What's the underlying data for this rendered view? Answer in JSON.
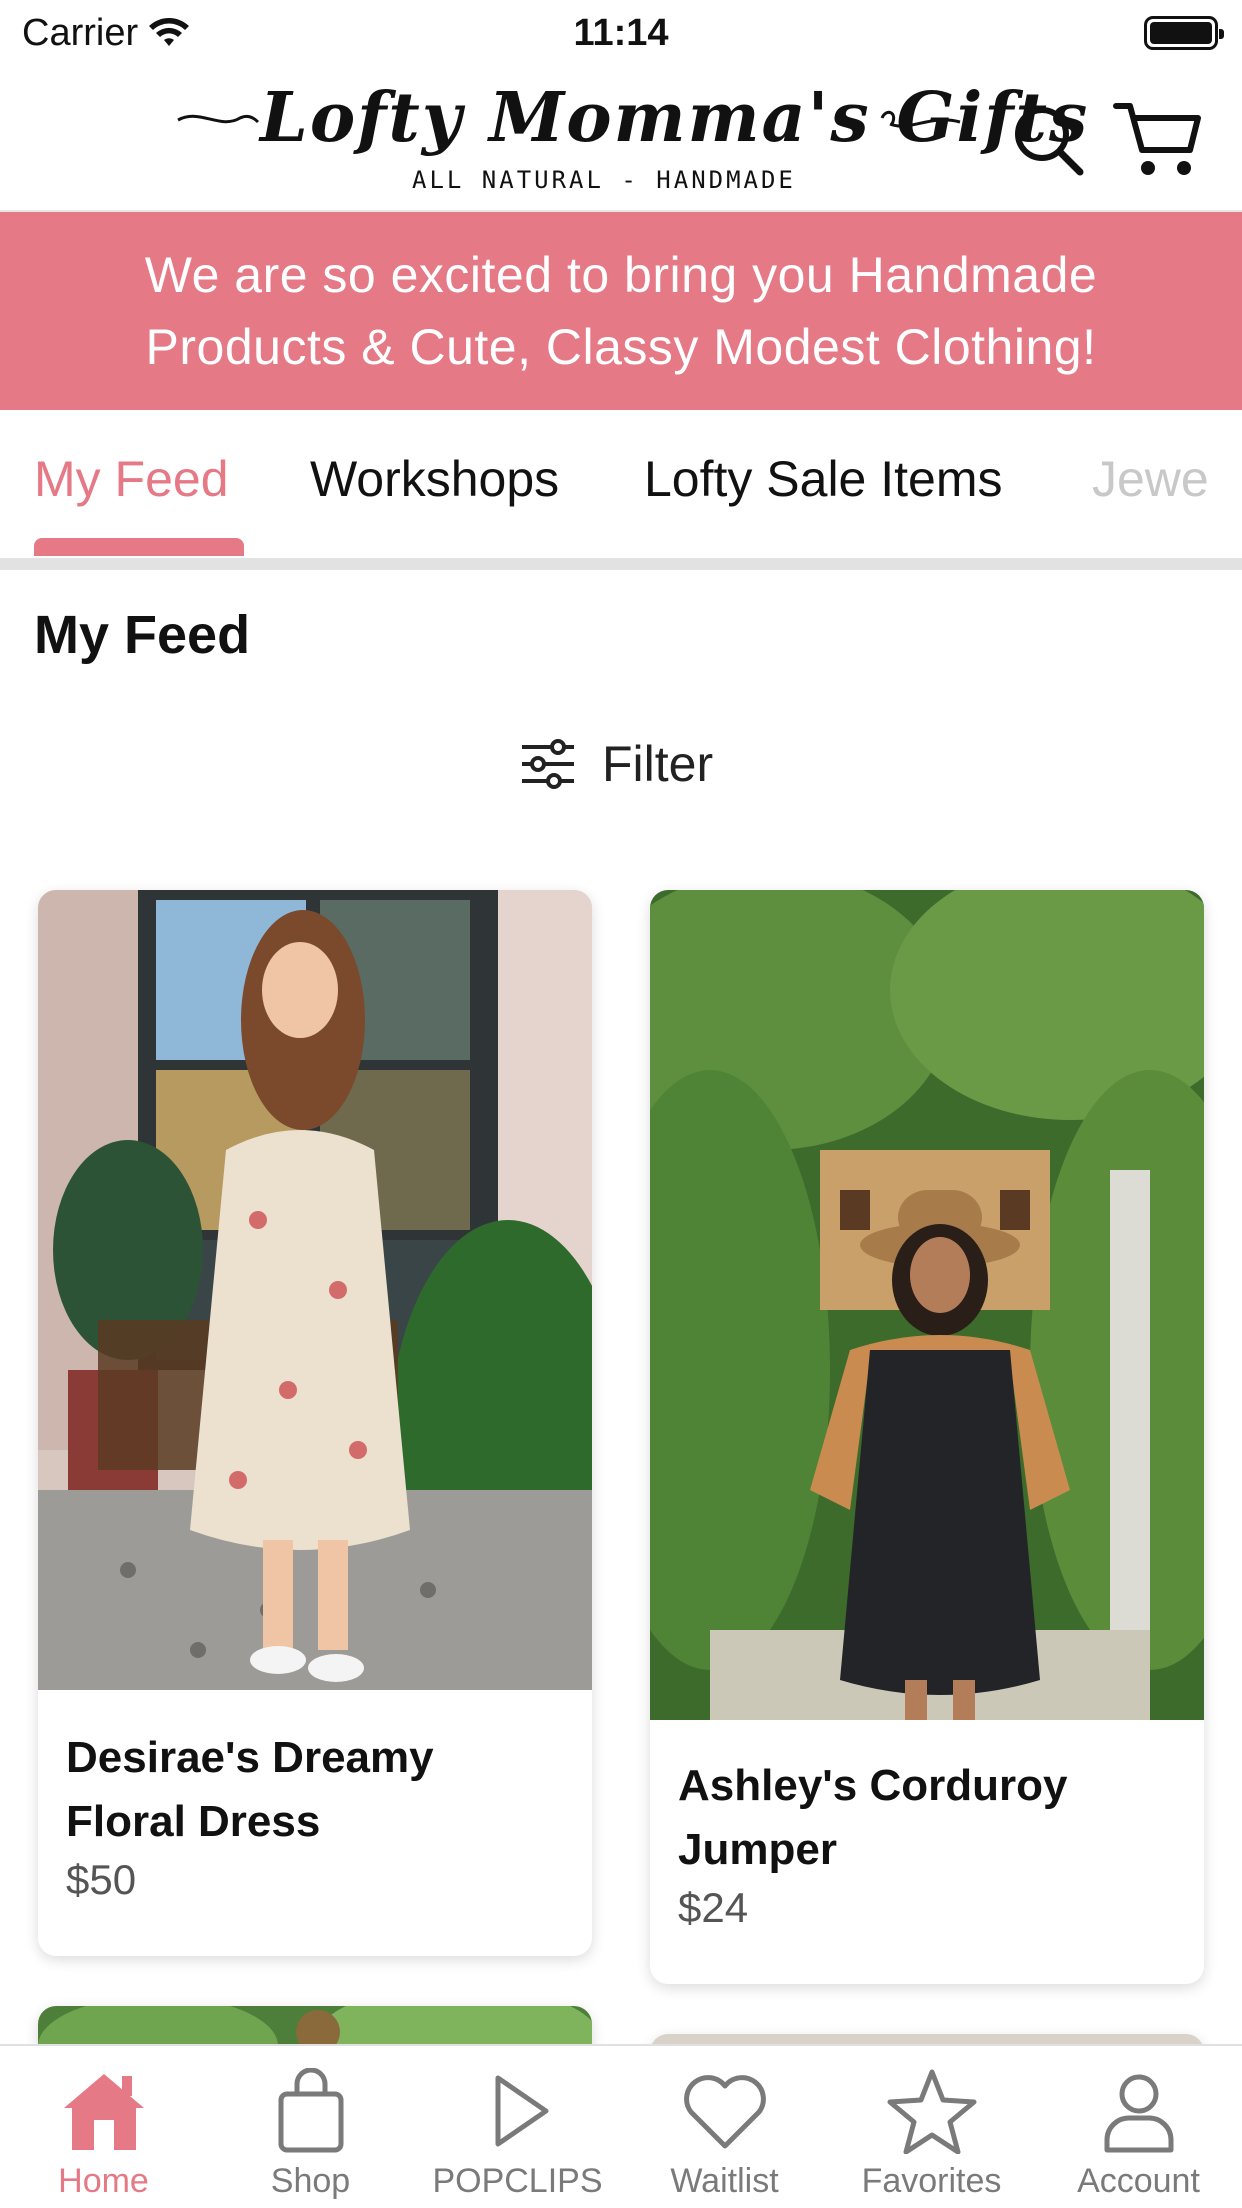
{
  "status_bar": {
    "carrier": "Carrier",
    "time": "11:14"
  },
  "header": {
    "logo_title": "Lofty Momma's Gifts",
    "logo_subtitle": "ALL NATURAL - HANDMADE"
  },
  "banner": {
    "text": "We are so excited to bring you Handmade Products & Cute, Classy Modest Clothing!"
  },
  "tabs": [
    {
      "label": "My Feed",
      "active": true
    },
    {
      "label": "Workshops"
    },
    {
      "label": "Lofty Sale Items"
    },
    {
      "label": "Jewe"
    }
  ],
  "feed": {
    "title": "My Feed",
    "filter_label": "Filter",
    "products": [
      {
        "name": "Desirae's Dreamy Floral Dress",
        "price": "$50"
      },
      {
        "name": "Ashley's Corduroy Jumper",
        "price": "$24"
      }
    ]
  },
  "bottom_nav": [
    {
      "label": "Home",
      "icon": "home-icon",
      "active": true
    },
    {
      "label": "Shop",
      "icon": "shopping-bag-icon"
    },
    {
      "label": "POPCLIPS",
      "icon": "play-icon"
    },
    {
      "label": "Waitlist",
      "icon": "heart-icon"
    },
    {
      "label": "Favorites",
      "icon": "star-icon"
    },
    {
      "label": "Account",
      "icon": "person-icon"
    }
  ],
  "colors": {
    "accent": "#e57986",
    "nav_inactive": "#7a7a7a",
    "divider": "#e2e2e2"
  }
}
